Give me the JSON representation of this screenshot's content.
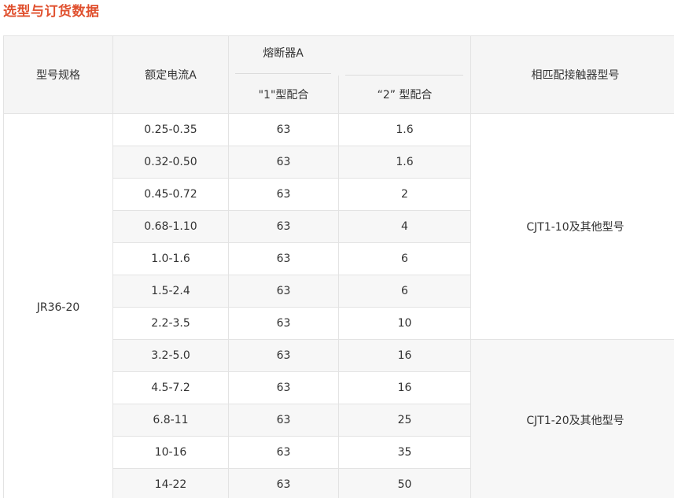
{
  "title": "选型与订货数据",
  "table": {
    "headers": {
      "model": "型号规格",
      "current": "额定电流A",
      "fuse": "熔断器A",
      "type1": "\"1\"型配合",
      "type2": "“2” 型配合",
      "contactor": "相匹配接触器型号"
    },
    "model_value": "JR36-20",
    "rows": [
      {
        "current": "0.25-0.35",
        "type1": "63",
        "type2": "1.6"
      },
      {
        "current": "0.32-0.50",
        "type1": "63",
        "type2": "1.6"
      },
      {
        "current": "0.45-0.72",
        "type1": "63",
        "type2": "2"
      },
      {
        "current": "0.68-1.10",
        "type1": "63",
        "type2": "4"
      },
      {
        "current": "1.0-1.6",
        "type1": "63",
        "type2": "6"
      },
      {
        "current": "1.5-2.4",
        "type1": "63",
        "type2": "6"
      },
      {
        "current": "2.2-3.5",
        "type1": "63",
        "type2": "10"
      },
      {
        "current": "3.2-5.0",
        "type1": "63",
        "type2": "16"
      },
      {
        "current": "4.5-7.2",
        "type1": "63",
        "type2": "16"
      },
      {
        "current": "6.8-11",
        "type1": "63",
        "type2": "25"
      },
      {
        "current": "10-16",
        "type1": "63",
        "type2": "35"
      },
      {
        "current": "14-22",
        "type1": "63",
        "type2": "50"
      }
    ],
    "contactor_groups": [
      "CJT1-10及其他型号",
      "CJT1-20及其他型号"
    ]
  }
}
